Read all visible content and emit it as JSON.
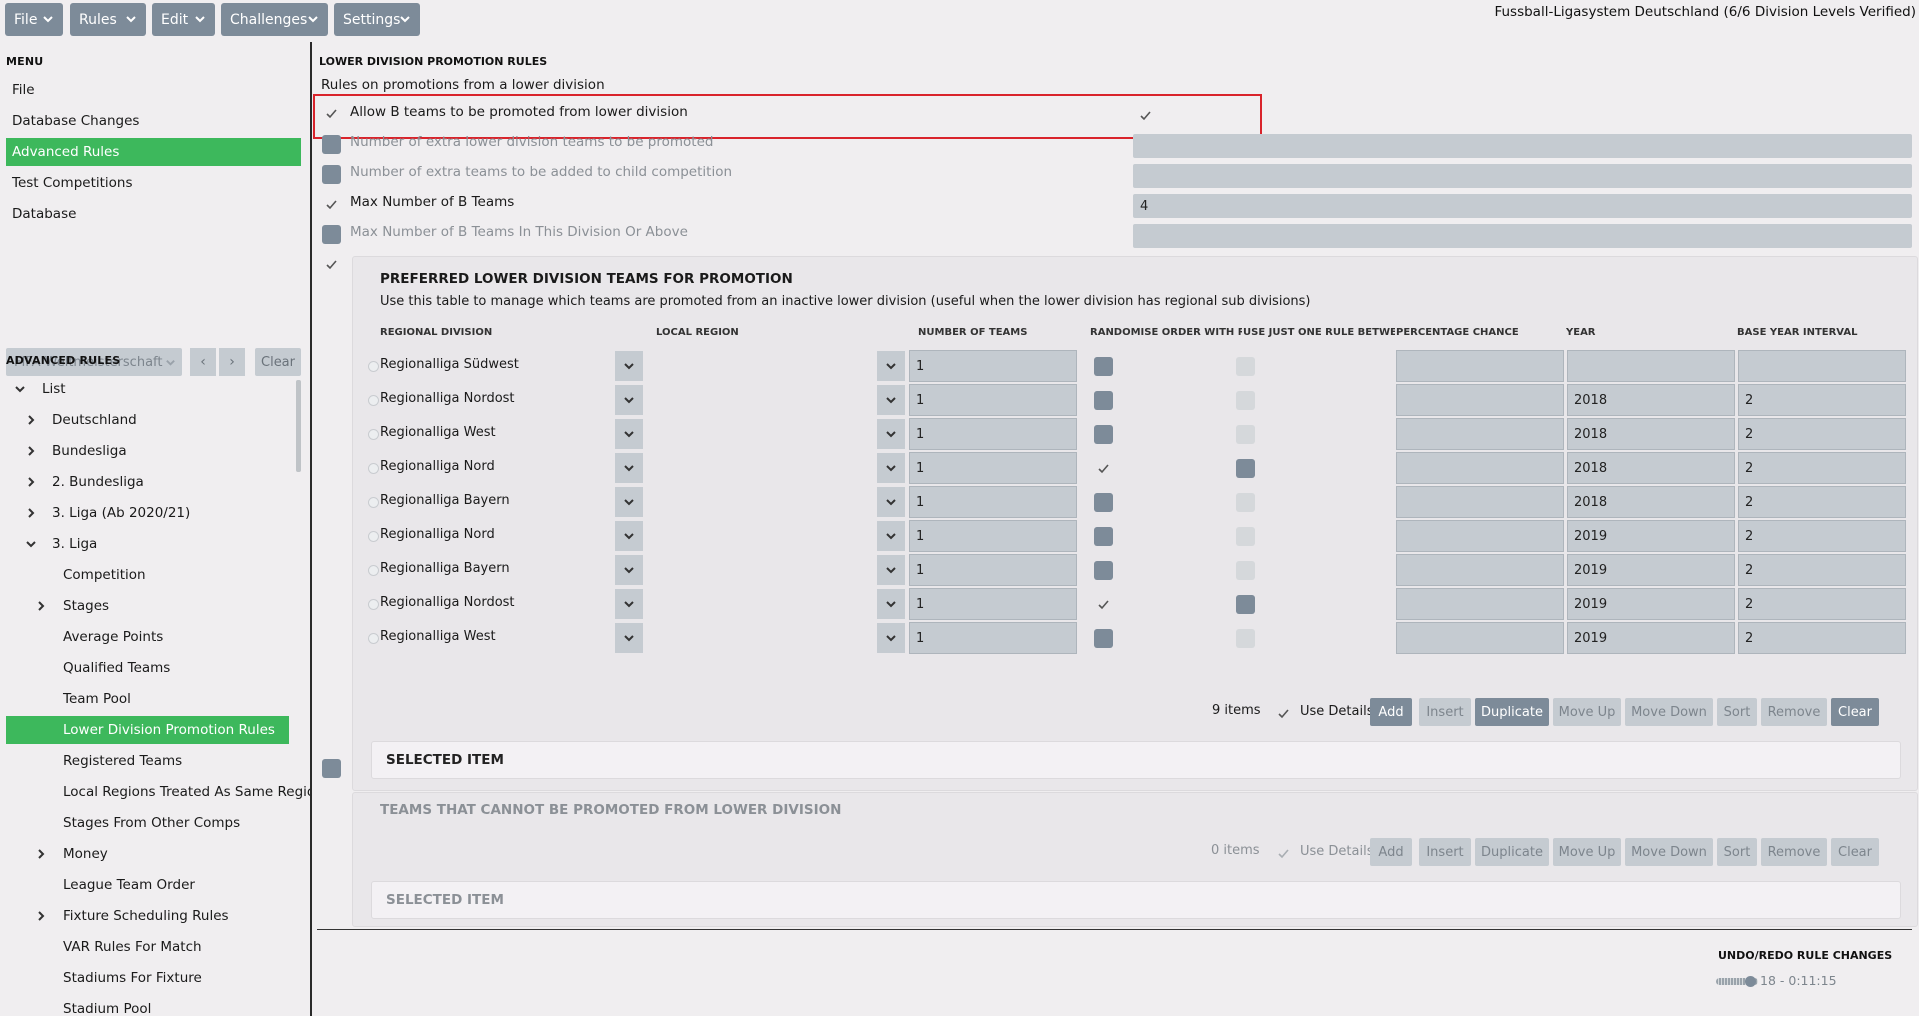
{
  "topbar": {
    "menus": [
      {
        "label": "File"
      },
      {
        "label": "Rules"
      },
      {
        "label": "Edit"
      },
      {
        "label": "Challenges"
      },
      {
        "label": "Settings"
      }
    ],
    "app_title": "Fussball-Ligasystem Deutschland (6/6 Division Levels Verified)"
  },
  "left": {
    "menu_title": "MENU",
    "menu_items": [
      "File",
      "Database Changes",
      "Advanced Rules",
      "Test Competitions",
      "Database"
    ],
    "filter": {
      "value": "FIFA Weltmeisterschaft",
      "prev": "‹",
      "next": "›",
      "clear": "Clear"
    },
    "advanced_title": "ADVANCED RULES",
    "tree": [
      {
        "label": "List",
        "level": 0,
        "expanded": true
      },
      {
        "label": "Deutschland",
        "level": 1
      },
      {
        "label": "Bundesliga",
        "level": 1
      },
      {
        "label": "2. Bundesliga",
        "level": 1
      },
      {
        "label": "3. Liga (Ab 2020/21)",
        "level": 1
      },
      {
        "label": "3. Liga",
        "level": 1,
        "expanded": true
      },
      {
        "label": "Competition",
        "level": 2,
        "leaf": true
      },
      {
        "label": "Stages",
        "level": 2
      },
      {
        "label": "Average Points",
        "level": 2,
        "leaf": true
      },
      {
        "label": "Qualified Teams",
        "level": 2,
        "leaf": true
      },
      {
        "label": "Team Pool",
        "level": 2,
        "leaf": true
      },
      {
        "label": "Lower Division Promotion Rules",
        "level": 2,
        "leaf": true,
        "active": true
      },
      {
        "label": "Registered Teams",
        "level": 2,
        "leaf": true
      },
      {
        "label": "Local Regions Treated As Same Regior",
        "level": 2,
        "leaf": true
      },
      {
        "label": "Stages From Other Comps",
        "level": 2,
        "leaf": true
      },
      {
        "label": "Money",
        "level": 2
      },
      {
        "label": "League Team Order",
        "level": 2,
        "leaf": true
      },
      {
        "label": "Fixture Scheduling Rules",
        "level": 2
      },
      {
        "label": "VAR Rules For Match",
        "level": 2,
        "leaf": true
      },
      {
        "label": "Stadiums For Fixture",
        "level": 2,
        "leaf": true
      },
      {
        "label": "Stadium Pool",
        "level": 2,
        "leaf": true
      }
    ]
  },
  "main": {
    "section_title": "LOWER DIVISION PROMOTION RULES",
    "subtitle": "Rules on promotions from a lower division",
    "rules": [
      {
        "label": "Allow B teams to be promoted from lower division",
        "checked": true,
        "value": "",
        "value_checkbox": true,
        "enabled": true
      },
      {
        "label": "Number of extra lower division teams to be promoted",
        "checked": false,
        "value": "",
        "enabled": false
      },
      {
        "label": "Number of extra teams to be added to child competition",
        "checked": false,
        "value": "",
        "enabled": false
      },
      {
        "label": "Max Number of B Teams",
        "checked": true,
        "value": "4",
        "enabled": true
      },
      {
        "label": "Max Number of B Teams In This Division Or Above",
        "checked": false,
        "value": "",
        "enabled": false
      }
    ],
    "preferred": {
      "title": "PREFERRED LOWER DIVISION TEAMS FOR PROMOTION",
      "description": "Use this table to manage which teams are promoted from an inactive lower division (useful when the lower division has regional sub divisions)",
      "columns": [
        "REGIONAL DIVISION",
        "LOCAL REGION",
        "NUMBER OF TEAMS",
        "RANDOMISE ORDER WITH RU...",
        "USE JUST ONE RULE BETWEE...",
        "PERCENTAGE CHANCE",
        "YEAR",
        "BASE YEAR INTERVAL"
      ],
      "rows": [
        {
          "division": "Regionalliga Südwest",
          "local": "",
          "number": "1",
          "randomise": false,
          "one_rule": false,
          "chance": "",
          "year": "",
          "interval": ""
        },
        {
          "division": "Regionalliga Nordost",
          "local": "",
          "number": "1",
          "randomise": false,
          "one_rule": false,
          "chance": "",
          "year": "2018",
          "interval": "2"
        },
        {
          "division": "Regionalliga West",
          "local": "",
          "number": "1",
          "randomise": false,
          "one_rule": false,
          "chance": "",
          "year": "2018",
          "interval": "2"
        },
        {
          "division": "Regionalliga Nord",
          "local": "",
          "number": "1",
          "randomise": true,
          "one_rule": true,
          "chance": "",
          "year": "2018",
          "interval": "2"
        },
        {
          "division": "Regionalliga Bayern",
          "local": "",
          "number": "1",
          "randomise": false,
          "one_rule": false,
          "chance": "",
          "year": "2018",
          "interval": "2"
        },
        {
          "division": "Regionalliga Nord",
          "local": "",
          "number": "1",
          "randomise": false,
          "one_rule": false,
          "chance": "",
          "year": "2019",
          "interval": "2"
        },
        {
          "division": "Regionalliga Bayern",
          "local": "",
          "number": "1",
          "randomise": false,
          "one_rule": false,
          "chance": "",
          "year": "2019",
          "interval": "2"
        },
        {
          "division": "Regionalliga Nordost",
          "local": "",
          "number": "1",
          "randomise": true,
          "one_rule": true,
          "chance": "",
          "year": "2019",
          "interval": "2"
        },
        {
          "division": "Regionalliga West",
          "local": "",
          "number": "1",
          "randomise": false,
          "one_rule": false,
          "chance": "",
          "year": "2019",
          "interval": "2"
        }
      ],
      "items_count": "9 items",
      "use_details": "Use Details Panel",
      "buttons": [
        "Add",
        "Insert",
        "Duplicate",
        "Move Up",
        "Move Down",
        "Sort",
        "Remove",
        "Clear"
      ],
      "selected_item": "SELECTED ITEM"
    },
    "blocked": {
      "title": "TEAMS THAT CANNOT BE PROMOTED FROM LOWER DIVISION",
      "items_count": "0 items",
      "use_details": "Use Details Panel",
      "buttons": [
        "Add",
        "Insert",
        "Duplicate",
        "Move Up",
        "Move Down",
        "Sort",
        "Remove",
        "Clear"
      ],
      "selected_item": "SELECTED ITEM"
    },
    "undo": {
      "title": "UNDO/REDO RULE CHANGES",
      "status": "18 - 0:11:15",
      "level": 0.8
    }
  }
}
